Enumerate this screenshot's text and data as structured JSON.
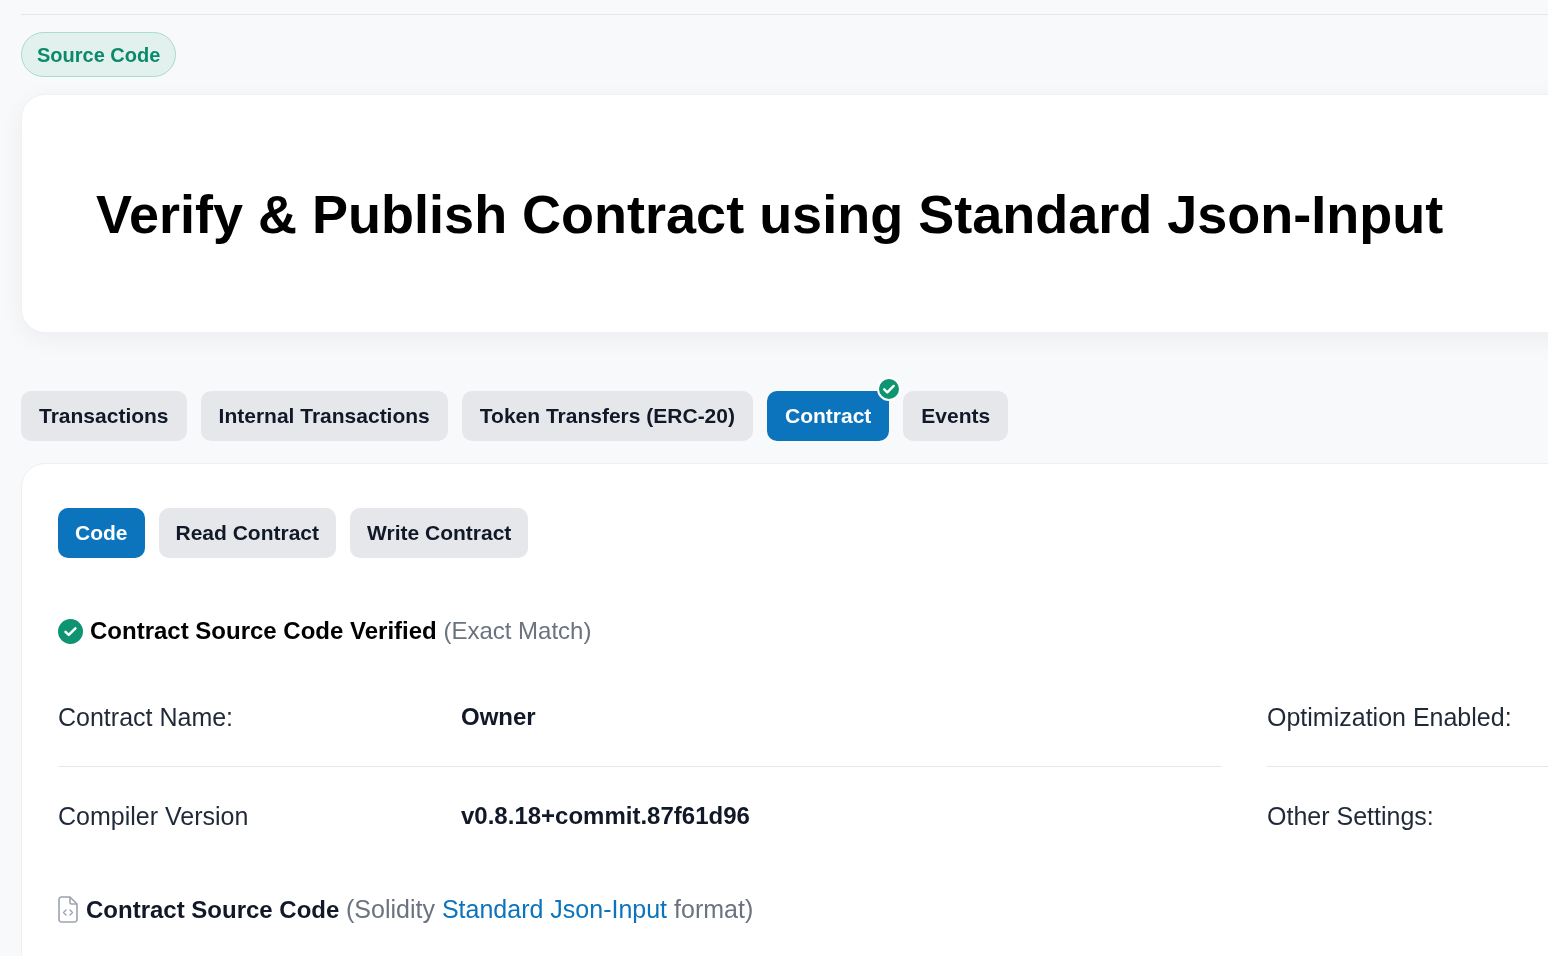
{
  "badge": {
    "label": "Source Code"
  },
  "hero": {
    "title": "Verify & Publish Contract using Standard Json-Input"
  },
  "tabs": [
    {
      "label": "Transactions",
      "selected": false,
      "verified": false
    },
    {
      "label": "Internal Transactions",
      "selected": false,
      "verified": false
    },
    {
      "label": "Token Transfers (ERC-20)",
      "selected": false,
      "verified": false
    },
    {
      "label": "Contract",
      "selected": true,
      "verified": true
    },
    {
      "label": "Events",
      "selected": false,
      "verified": false
    }
  ],
  "contract_panel": {
    "sub_tabs": [
      {
        "label": "Code",
        "selected": true
      },
      {
        "label": "Read Contract",
        "selected": false
      },
      {
        "label": "Write Contract",
        "selected": false
      }
    ],
    "verification": {
      "verified": true,
      "title": "Contract Source Code Verified",
      "note": "(Exact Match)"
    },
    "details_left": [
      {
        "label": "Contract Name:",
        "value": "Owner"
      },
      {
        "label": "Compiler Version",
        "value": "v0.8.18+commit.87f61d96"
      }
    ],
    "details_right": [
      {
        "label": "Optimization Enabled:"
      },
      {
        "label": "Other Settings:"
      }
    ],
    "source_code": {
      "title": "Contract Source Code",
      "prefix": "(Solidity",
      "link": "Standard Json-Input",
      "suffix": "format)"
    }
  }
}
